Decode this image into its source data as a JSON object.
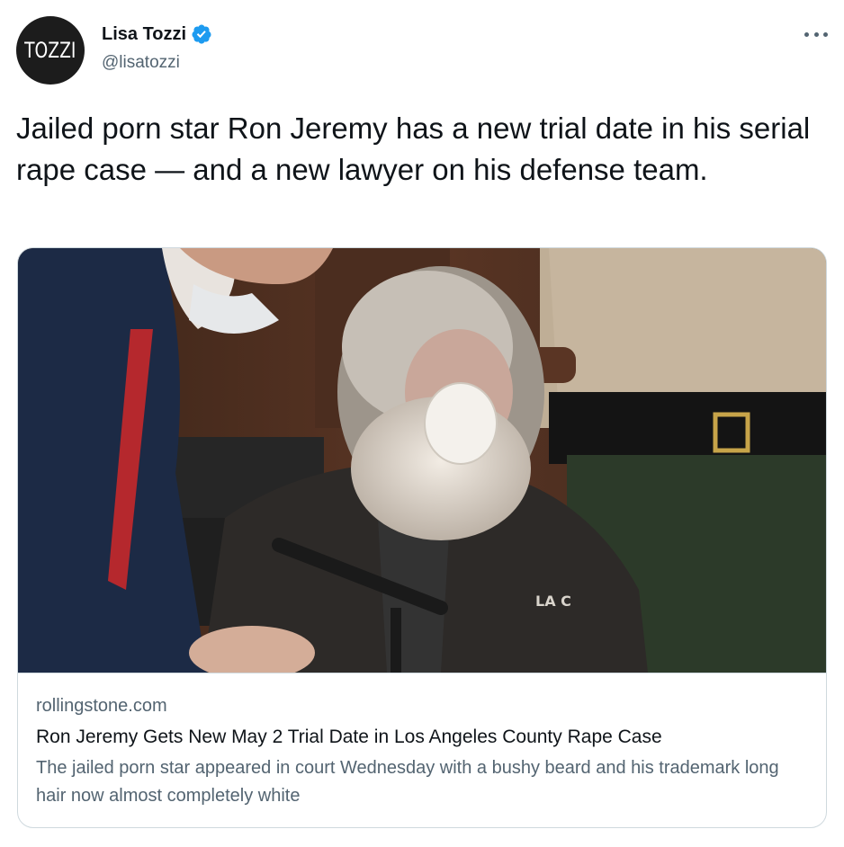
{
  "author": {
    "avatar_text": "TOZZI",
    "name": "Lisa Tozzi",
    "handle": "@lisatozzi",
    "verified": true,
    "verified_color": "#1d9bf0"
  },
  "tweet": {
    "text": "Jailed porn star Ron Jeremy has a new trial date in his serial rape case — and a new lawyer on his defense team."
  },
  "card": {
    "domain": "rollingstone.com",
    "title": "Ron Jeremy Gets New May 2 Trial Date in Los Angeles County Rape Case",
    "description": "The jailed porn star appeared in court Wednesday with a bushy beard and his trademark long hair now almost completely white",
    "image_shirt_text": "LA C"
  },
  "icons": {
    "more": "more-horizontal-icon",
    "verified": "verified-badge-icon"
  },
  "colors": {
    "text": "#0f1419",
    "secondary": "#536471",
    "border": "#cfd9de"
  }
}
